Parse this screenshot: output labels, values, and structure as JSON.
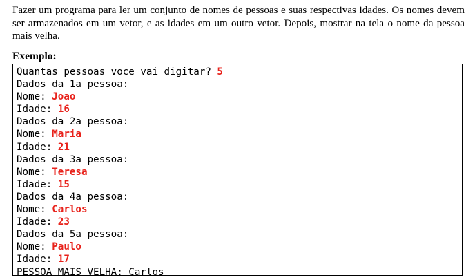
{
  "statement": "Fazer um programa para ler um conjunto de nomes de pessoas e suas respectivas idades. Os nomes devem ser armazenados em um vetor, e as idades em um outro vetor. Depois, mostrar na tela o nome da pessoa mais velha.",
  "example_label": "Exemplo:",
  "colors": {
    "input_text": "#e8221b"
  },
  "console": [
    {
      "prompt": "Quantas pessoas voce vai digitar? ",
      "input": "5"
    },
    {
      "prompt": "Dados da 1a pessoa:",
      "input": ""
    },
    {
      "prompt": "Nome: ",
      "input": "Joao"
    },
    {
      "prompt": "Idade: ",
      "input": "16"
    },
    {
      "prompt": "Dados da 2a pessoa:",
      "input": ""
    },
    {
      "prompt": "Nome: ",
      "input": "Maria"
    },
    {
      "prompt": "Idade: ",
      "input": "21"
    },
    {
      "prompt": "Dados da 3a pessoa:",
      "input": ""
    },
    {
      "prompt": "Nome: ",
      "input": "Teresa"
    },
    {
      "prompt": "Idade: ",
      "input": "15"
    },
    {
      "prompt": "Dados da 4a pessoa:",
      "input": ""
    },
    {
      "prompt": "Nome: ",
      "input": "Carlos"
    },
    {
      "prompt": "Idade: ",
      "input": "23"
    },
    {
      "prompt": "Dados da 5a pessoa:",
      "input": ""
    },
    {
      "prompt": "Nome: ",
      "input": "Paulo"
    },
    {
      "prompt": "Idade: ",
      "input": "17"
    },
    {
      "prompt": "PESSOA MAIS VELHA: Carlos",
      "input": ""
    }
  ]
}
